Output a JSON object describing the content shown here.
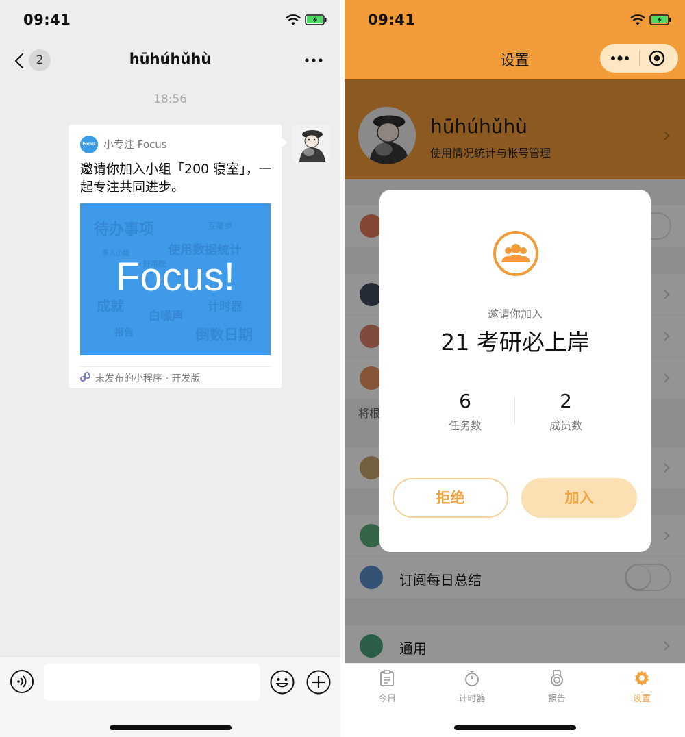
{
  "left_screen": {
    "status": {
      "time": "09:41"
    },
    "nav": {
      "unread_count": "2",
      "title": "hūhúhǔhù"
    },
    "timestamp": "18:56",
    "card": {
      "mini_program_logo_text": "Focus",
      "mini_program_name": "小专注 Focus",
      "message": "邀请你加入小组「200 寝室」，一起专注共同进步。",
      "cover_title": "Focus!",
      "cover_words": [
        "待办事项",
        "互帮步",
        "多入小组",
        "使用数据统计",
        "好用数",
        "成就",
        "白噪声",
        "计时器",
        "报告",
        "倒数日期"
      ],
      "footer": "未发布的小程序 · 开发版"
    },
    "input": {
      "value": ""
    }
  },
  "right_screen": {
    "status": {
      "time": "09:41"
    },
    "header": {
      "title": "设置"
    },
    "profile": {
      "name": "hūhúhǔhù",
      "subtitle": "使用情况统计与帐号管理"
    },
    "list": {
      "note": "将根",
      "subscribe_label": "订阅每日总结",
      "general_label": "通用"
    },
    "modal": {
      "invite_label": "邀请你加入",
      "group_name": "21 考研必上岸",
      "tasks_count": "6",
      "tasks_label": "任务数",
      "members_count": "2",
      "members_label": "成员数",
      "reject_label": "拒绝",
      "join_label": "加入"
    },
    "tabs": [
      {
        "label": "今日",
        "icon": "clipboard-icon"
      },
      {
        "label": "计时器",
        "icon": "stopwatch-icon"
      },
      {
        "label": "报告",
        "icon": "medal-icon"
      },
      {
        "label": "设置",
        "icon": "gear-icon"
      }
    ]
  },
  "colors": {
    "accent_orange": "#f19c39",
    "chat_bg": "#ededed",
    "focus_blue": "#3f9ae9",
    "button_text": "#f0a33e"
  }
}
